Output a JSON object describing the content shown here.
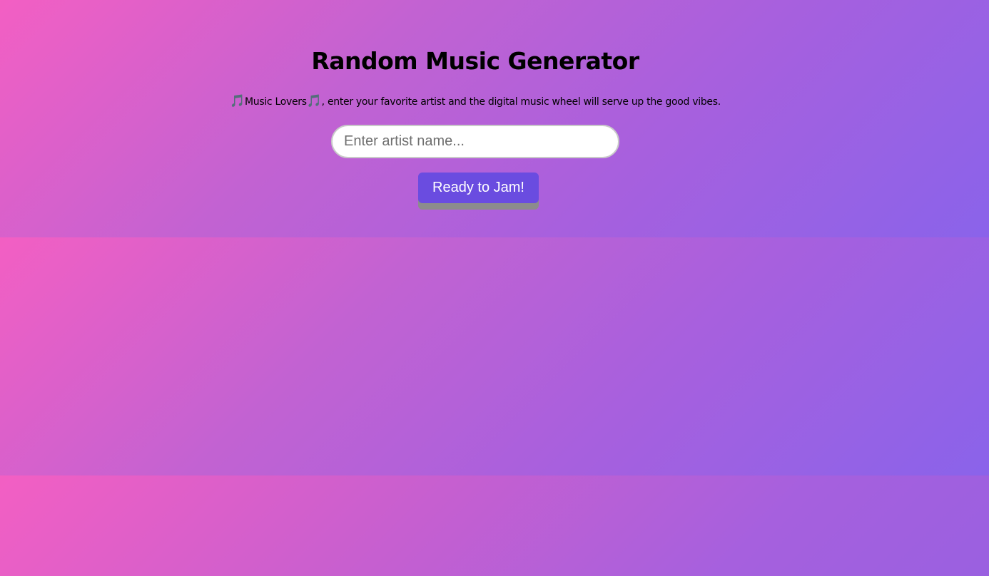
{
  "app": {
    "title": "Random Music Generator",
    "subtitle": {
      "note_left": "🎵",
      "label": "Music Lovers",
      "note_right": "🎵",
      "rest": ", enter your favorite artist and the digital music wheel will serve up the good vibes."
    }
  },
  "search": {
    "placeholder": "Enter artist name...",
    "value": ""
  },
  "actions": {
    "submit_label": "Ready to Jam!"
  },
  "colors": {
    "gradient_start": "#f35fc3",
    "gradient_end": "#8a63ea",
    "button_bg": "#6a4ce0",
    "button_shadow": "#8c8c8c"
  }
}
